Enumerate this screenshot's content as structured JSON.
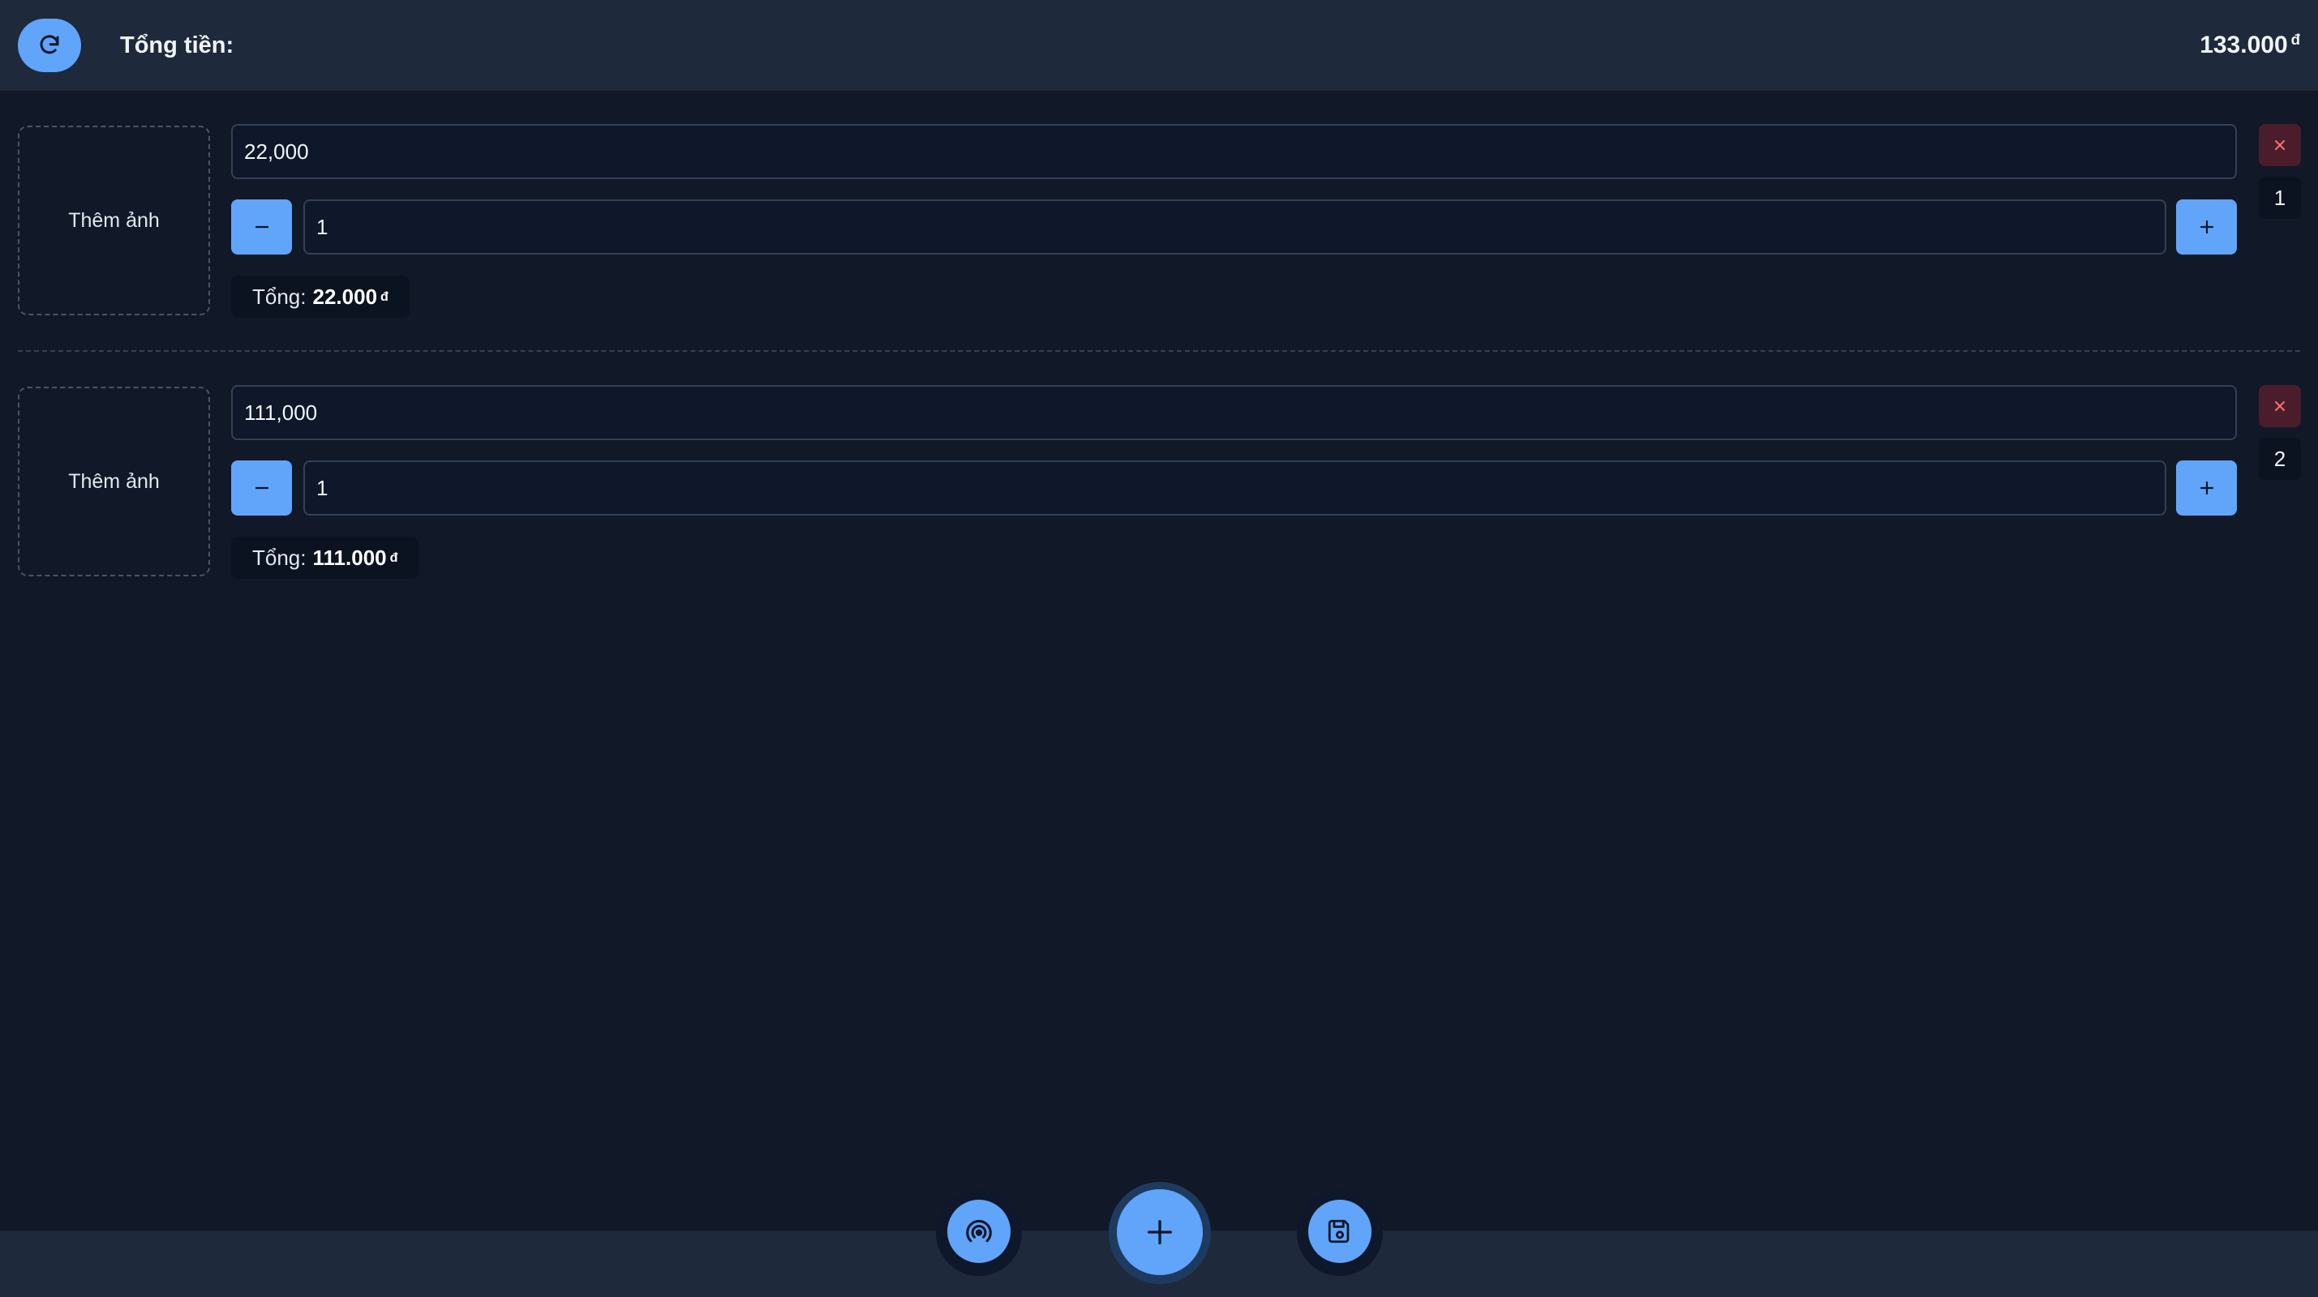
{
  "header": {
    "refresh_icon": "refresh-icon",
    "total_label": "Tổng tiền:",
    "total_value": "133.000",
    "currency": "đ"
  },
  "items": [
    {
      "photo_label": "Thêm ảnh",
      "price": "22,000",
      "quantity": "1",
      "total_label": "Tổng:",
      "total_value": "22.000",
      "currency": "đ",
      "index": "1"
    },
    {
      "photo_label": "Thêm ảnh",
      "price": "111,000",
      "quantity": "1",
      "total_label": "Tổng:",
      "total_value": "111.000",
      "currency": "đ",
      "index": "2"
    }
  ],
  "footer": {
    "left_icon": "broadcast-icon",
    "center_icon": "plus-icon",
    "right_icon": "save-icon"
  },
  "colors": {
    "background": "#111827",
    "bar": "#1e293b",
    "accent": "#60a5fa",
    "danger_bg": "#4b1d2a",
    "danger_fg": "#f87171"
  }
}
